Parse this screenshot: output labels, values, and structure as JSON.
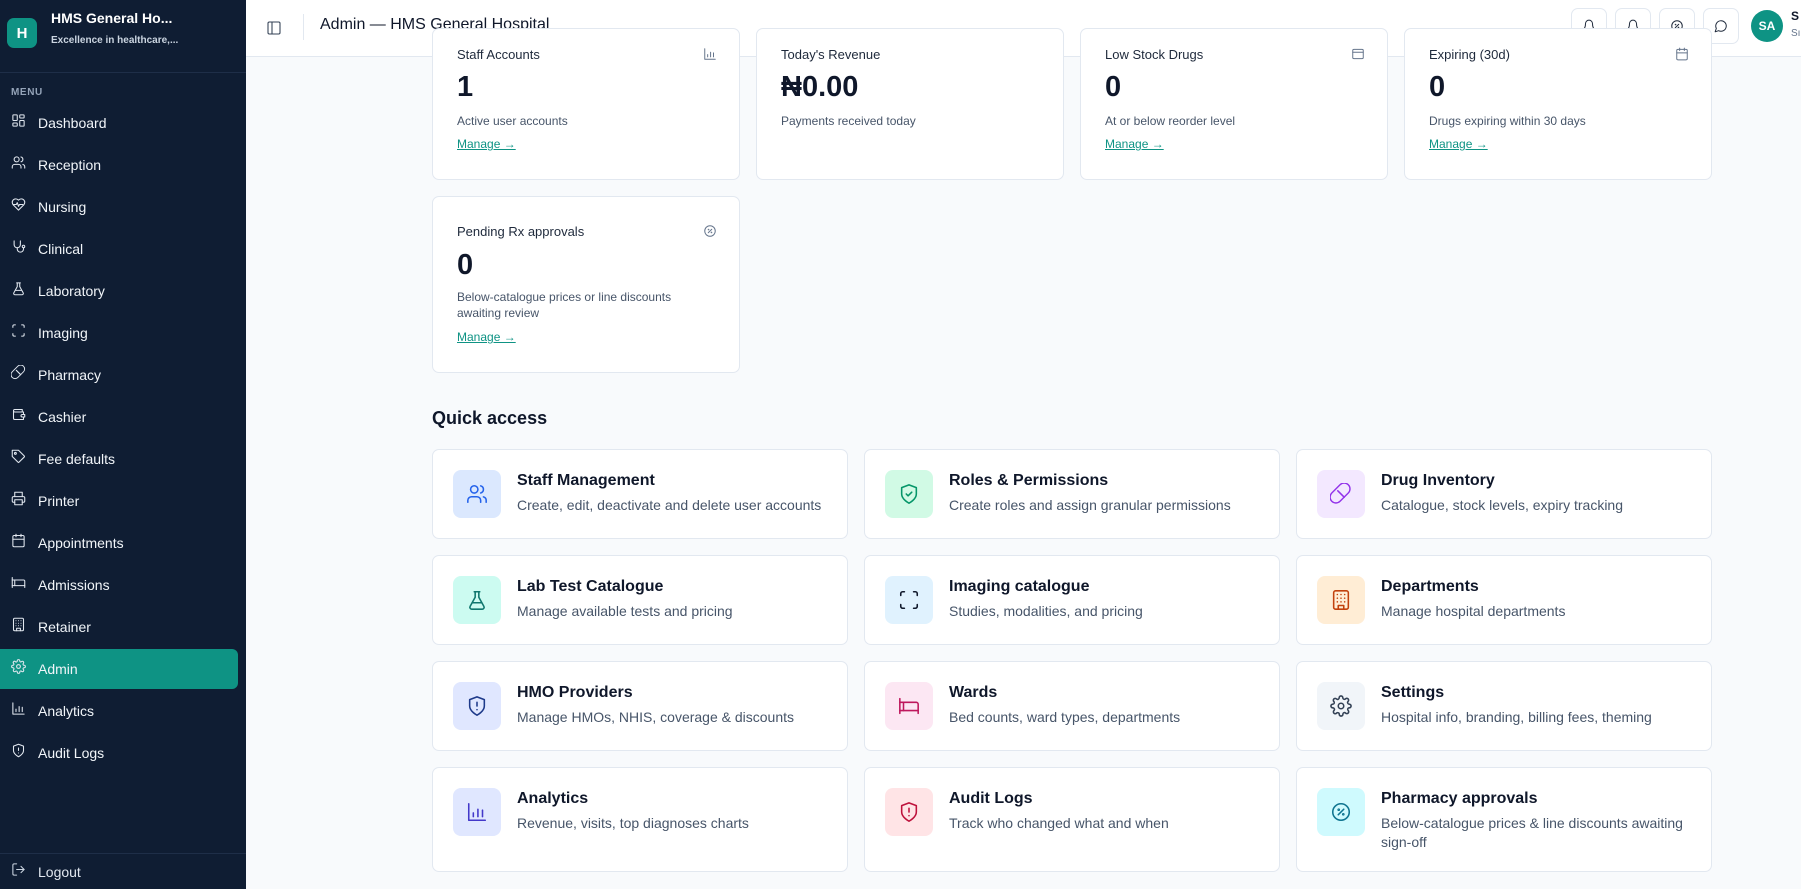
{
  "brand": {
    "logo_letter": "H",
    "name": "HMS General Ho...",
    "tagline": "Excellence in healthcare,..."
  },
  "sidebar": {
    "menu_label": "MENU",
    "items": [
      {
        "label": "Dashboard",
        "icon": "dashboard-icon"
      },
      {
        "label": "Reception",
        "icon": "users-icon"
      },
      {
        "label": "Nursing",
        "icon": "heart-pulse-icon"
      },
      {
        "label": "Clinical",
        "icon": "stethoscope-icon"
      },
      {
        "label": "Laboratory",
        "icon": "flask-icon"
      },
      {
        "label": "Imaging",
        "icon": "scan-icon"
      },
      {
        "label": "Pharmacy",
        "icon": "pill-icon"
      },
      {
        "label": "Cashier",
        "icon": "wallet-icon"
      },
      {
        "label": "Fee defaults",
        "icon": "tag-icon"
      },
      {
        "label": "Printer",
        "icon": "printer-icon"
      },
      {
        "label": "Appointments",
        "icon": "calendar-icon"
      },
      {
        "label": "Admissions",
        "icon": "bed-icon"
      },
      {
        "label": "Retainer",
        "icon": "building-icon"
      },
      {
        "label": "Admin",
        "icon": "gear-icon",
        "active": true
      },
      {
        "label": "Analytics",
        "icon": "bar-chart-icon"
      },
      {
        "label": "Audit Logs",
        "icon": "shield-icon"
      }
    ],
    "logout_label": "Logout"
  },
  "header": {
    "title": "Admin — HMS General Hospital",
    "user_initials": "SA",
    "user_name": "S",
    "user_role": "Sı"
  },
  "stats": [
    {
      "label": "Staff Accounts",
      "value": "1",
      "sub": "Active user accounts",
      "link": "Manage →",
      "icon": "bar-chart-icon"
    },
    {
      "label": "Today's Revenue",
      "value": "₦0.00",
      "sub": "Payments received today",
      "link": "",
      "icon": ""
    },
    {
      "label": "Low Stock Drugs",
      "value": "0",
      "sub": "At or below reorder level",
      "link": "Manage →",
      "icon": "box-icon"
    },
    {
      "label": "Expiring (30d)",
      "value": "0",
      "sub": "Drugs expiring within 30 days",
      "link": "Manage →",
      "icon": "calendar-icon"
    },
    {
      "label": "Pending Rx approvals",
      "value": "0",
      "sub": "Below-catalogue prices or line discounts awaiting review",
      "link": "Manage →",
      "icon": "badge-percent-icon"
    }
  ],
  "quick_access": {
    "title": "Quick access",
    "cards": [
      {
        "title": "Staff Management",
        "desc": "Create, edit, deactivate and delete user accounts",
        "icon": "users-icon",
        "bg": "#dbe8fe",
        "fg": "#2563eb"
      },
      {
        "title": "Roles & Permissions",
        "desc": "Create roles and assign granular permissions",
        "icon": "shield-check-icon",
        "bg": "#d1fae5",
        "fg": "#059669"
      },
      {
        "title": "Drug Inventory",
        "desc": "Catalogue, stock levels, expiry tracking",
        "icon": "pill-icon",
        "bg": "#f3e8ff",
        "fg": "#9333ea"
      },
      {
        "title": "Lab Test Catalogue",
        "desc": "Manage available tests and pricing",
        "icon": "flask-icon",
        "bg": "#ccfbf1",
        "fg": "#0f766e"
      },
      {
        "title": "Imaging catalogue",
        "desc": "Studies, modalities, and pricing",
        "icon": "scan-icon",
        "bg": "#e0f2fe",
        "fg": "#0f172a"
      },
      {
        "title": "Departments",
        "desc": "Manage hospital departments",
        "icon": "building-icon",
        "bg": "#ffedd5",
        "fg": "#c2410c"
      },
      {
        "title": "HMO Providers",
        "desc": "Manage HMOs, NHIS, coverage & discounts",
        "icon": "shield-alert-icon",
        "bg": "#e0e7ff",
        "fg": "#1e3a8a"
      },
      {
        "title": "Wards",
        "desc": "Bed counts, ward types, departments",
        "icon": "bed-icon",
        "bg": "#fce7f3",
        "fg": "#be185d"
      },
      {
        "title": "Settings",
        "desc": "Hospital info, branding, billing fees, theming",
        "icon": "gear-icon",
        "bg": "#f1f5f9",
        "fg": "#334155"
      },
      {
        "title": "Analytics",
        "desc": "Revenue, visits, top diagnoses charts",
        "icon": "bar-chart-icon",
        "bg": "#e0e7ff",
        "fg": "#4338ca"
      },
      {
        "title": "Audit Logs",
        "desc": "Track who changed what and when",
        "icon": "shield-alert-icon",
        "bg": "#ffe4e6",
        "fg": "#be123c"
      },
      {
        "title": "Pharmacy approvals",
        "desc": "Below-catalogue prices & line discounts awaiting sign-off",
        "icon": "badge-percent-icon",
        "bg": "#cffafe",
        "fg": "#0e7490"
      }
    ]
  },
  "colors": {
    "sidebar_bg": "#0f1d33",
    "accent": "#0e9384"
  }
}
